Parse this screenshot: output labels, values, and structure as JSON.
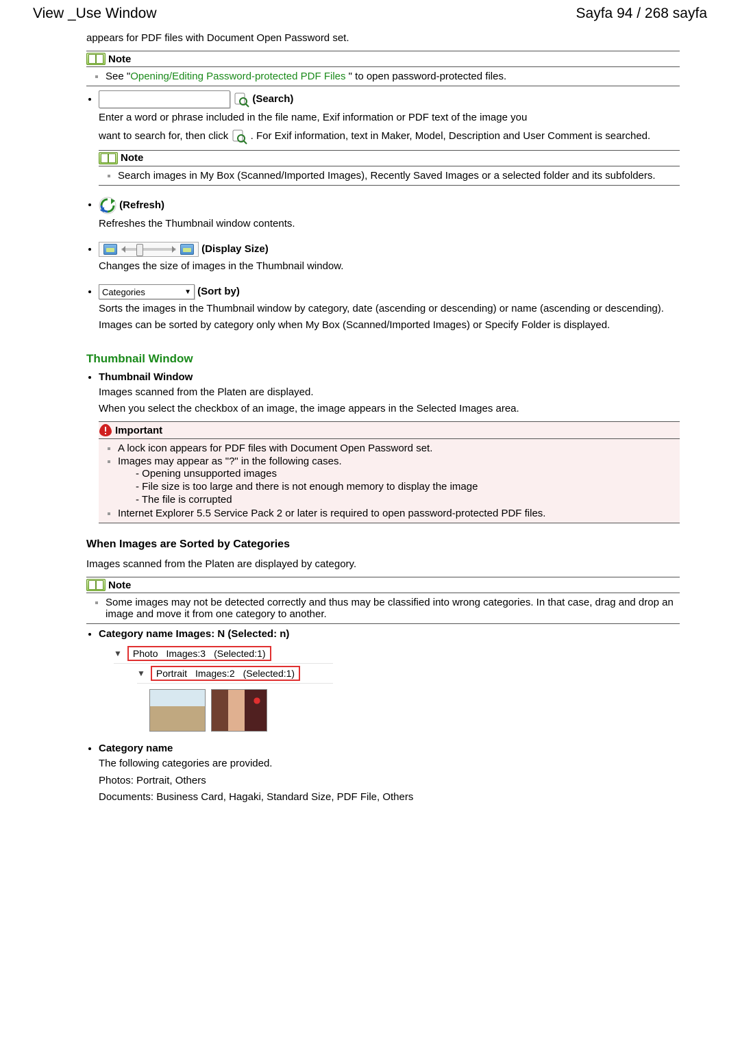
{
  "header": {
    "left": "View _Use Window",
    "right": "Sayfa 94 / 268 sayfa"
  },
  "intro_pdf": "appears for PDF files with Document Open Password set.",
  "note1": {
    "title": "Note",
    "pre": "See \"",
    "link": "Opening/Editing Password-protected PDF Files",
    "post": " \" to open password-protected files."
  },
  "search": {
    "label": " (Search)",
    "line1": "Enter a word or phrase included in the file name, Exif information or PDF text of the image you",
    "line2a": "want to search for, then click ",
    "line2b": ". For Exif information, text in Maker, Model, Description and User Comment is searched."
  },
  "note2": {
    "title": "Note",
    "text": "Search images in My Box (Scanned/Imported Images), Recently Saved Images or a selected folder and its subfolders."
  },
  "refresh": {
    "label": " (Refresh)",
    "text": "Refreshes the Thumbnail window contents."
  },
  "display": {
    "label": " (Display Size)",
    "text": "Changes the size of images in the Thumbnail window."
  },
  "sortby": {
    "dropdown": "Categories",
    "label": " (Sort by)",
    "text1": "Sorts the images in the Thumbnail window by category, date (ascending or descending) or name (ascending or descending).",
    "text2": "Images can be sorted by category only when My Box (Scanned/Imported Images) or Specify Folder is displayed."
  },
  "thumb_section": {
    "title": "Thumbnail Window",
    "bullet_title": "Thumbnail Window",
    "p1": "Images scanned from the Platen are displayed.",
    "p2": "When you select the checkbox of an image, the image appears in the Selected Images area."
  },
  "important": {
    "title": "Important",
    "i1": "A lock icon appears for PDF files with Document Open Password set.",
    "i2": "Images may appear as \"?\" in the following cases.",
    "d1": "- Opening unsupported images",
    "d2": "- File size is too large and there is not enough memory to display the image",
    "d3": "- The file is corrupted",
    "i3": "Internet Explorer 5.5 Service Pack 2 or later is required to open password-protected PDF files."
  },
  "sorted": {
    "title": "When Images are Sorted by Categories",
    "intro": "Images scanned from the Platen are displayed by category."
  },
  "note3": {
    "title": "Note",
    "text": "Some images may not be detected correctly and thus may be classified into wrong categories. In that case, drag and drop an image and move it from one category to another."
  },
  "cat_label_bullet": "Category name Images: N (Selected: n)",
  "tree": {
    "row1": {
      "cat": "Photo",
      "imgs": "Images:3",
      "sel": "(Selected:1)"
    },
    "row2": {
      "cat": "Portrait",
      "imgs": "Images:2",
      "sel": "(Selected:1)"
    }
  },
  "cat_name": {
    "label": "Category name",
    "p1": "The following categories are provided.",
    "p2": "Photos: Portrait, Others",
    "p3": "Documents: Business Card, Hagaki, Standard Size, PDF File, Others"
  }
}
